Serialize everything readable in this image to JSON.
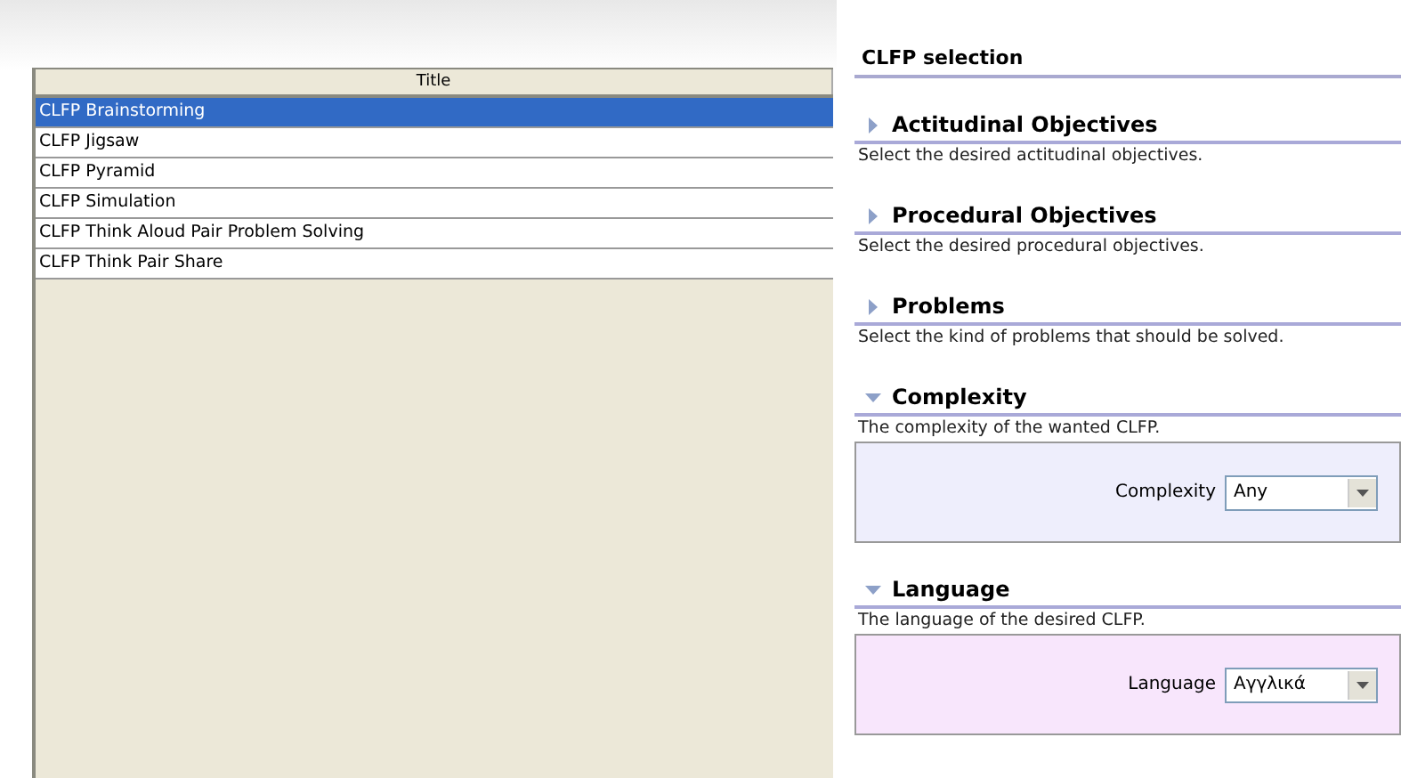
{
  "table": {
    "columns": [
      "Title"
    ],
    "rows": [
      {
        "title": "CLFP Brainstorming",
        "selected": true
      },
      {
        "title": "CLFP Jigsaw",
        "selected": false
      },
      {
        "title": "CLFP Pyramid",
        "selected": false
      },
      {
        "title": "CLFP Simulation",
        "selected": false
      },
      {
        "title": "CLFP Think Aloud Pair Problem Solving",
        "selected": false
      },
      {
        "title": "CLFP Think Pair Share",
        "selected": false
      }
    ]
  },
  "selection": {
    "title": "CLFP selection",
    "sections": [
      {
        "title": "Actitudinal Objectives",
        "description": "Select the desired actitudinal objectives.",
        "expanded": false
      },
      {
        "title": "Procedural Objectives",
        "description": "Select the desired procedural objectives.",
        "expanded": false
      },
      {
        "title": "Problems",
        "description": "Select the kind of problems that should be solved.",
        "expanded": false
      },
      {
        "title": "Complexity",
        "description": "The complexity of the wanted CLFP.",
        "expanded": true,
        "color": "#eeeefc",
        "field": {
          "label": "Complexity",
          "value": "Any"
        }
      },
      {
        "title": "Language",
        "description": "The language of the desired CLFP.",
        "expanded": true,
        "color": "#f8e6fc",
        "field": {
          "label": "Language",
          "value": "Αγγλικά"
        }
      }
    ]
  }
}
